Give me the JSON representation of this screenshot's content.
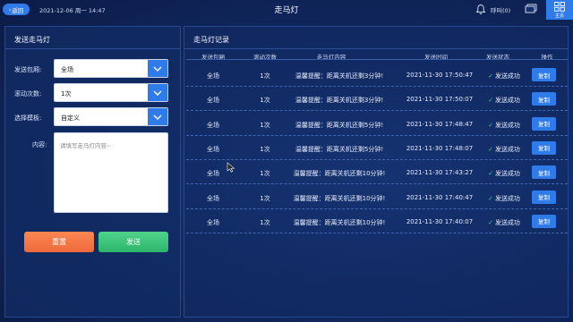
{
  "topbar": {
    "back_label": "返回",
    "datetime": "2021-12-06 周一 14:47",
    "title": "走马灯",
    "call_label": "呼叫(0)",
    "home_label": "主页"
  },
  "left_panel": {
    "title": "发送走马灯",
    "fields": {
      "package_label": "发送包厢:",
      "package_value": "全场",
      "scroll_label": "滚动次数:",
      "scroll_value": "1次",
      "template_label": "选择模板:",
      "template_value": "自定义",
      "content_label": "内容:",
      "content_placeholder": "请填写走马灯内容~"
    },
    "reset_label": "重置",
    "send_label": "发送"
  },
  "right_panel": {
    "title": "走马灯记录",
    "columns": [
      "发送包厢",
      "滚动次数",
      "走马灯内容",
      "发送时间",
      "发送状态",
      "操作"
    ],
    "rows": [
      {
        "package": "全场",
        "count": "1次",
        "content": "温馨提醒：距离关机还剩3分钟!",
        "time": "2021-11-30 17:50:47",
        "status": "发送成功",
        "action": "复制"
      },
      {
        "package": "全场",
        "count": "1次",
        "content": "温馨提醒：距离关机还剩3分钟!",
        "time": "2021-11-30 17:50:07",
        "status": "发送成功",
        "action": "复制"
      },
      {
        "package": "全场",
        "count": "1次",
        "content": "温馨提醒：距离关机还剩5分钟!",
        "time": "2021-11-30 17:48:47",
        "status": "发送成功",
        "action": "复制"
      },
      {
        "package": "全场",
        "count": "1次",
        "content": "温馨提醒：距离关机还剩5分钟!",
        "time": "2021-11-30 17:48:07",
        "status": "发送成功",
        "action": "复制"
      },
      {
        "package": "全场",
        "count": "1次",
        "content": "温馨提醒：距离关机还剩10分钟!",
        "time": "2021-11-30 17:43:27",
        "status": "发送成功",
        "action": "复制"
      },
      {
        "package": "全场",
        "count": "1次",
        "content": "温馨提醒：距离关机还剩10分钟!",
        "time": "2021-11-30 17:40:47",
        "status": "发送成功",
        "action": "复制"
      },
      {
        "package": "全场",
        "count": "1次",
        "content": "温馨提醒：距离关机还剩10分钟!",
        "time": "2021-11-30 17:40:07",
        "status": "发送成功",
        "action": "复制"
      }
    ]
  },
  "colors": {
    "accent": "#2f7bea",
    "reset": "#ee6a3b",
    "send": "#2db56c",
    "success_check": "#3ed07c"
  },
  "icons": [
    "chevron-left-icon",
    "bell-icon",
    "screen-icon",
    "home-grid-icon",
    "chevron-down-icon",
    "check-icon",
    "mouse-cursor-icon"
  ]
}
